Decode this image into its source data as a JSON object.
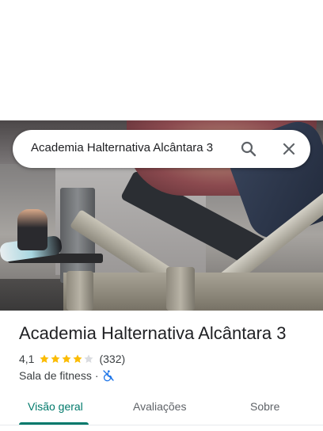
{
  "search": {
    "query": "Academia Halternativa Alcântara 3",
    "search_icon": "search-icon",
    "close_icon": "close-icon"
  },
  "place": {
    "name": "Academia Halternativa Alcântara 3",
    "rating": "4,1",
    "rating_value": 4.1,
    "review_count": "(332)",
    "category": "Sala de fitness",
    "separator": "·",
    "accessibility_icon": "wheelchair-not-accessible-icon"
  },
  "tabs": [
    {
      "label": "Visão geral",
      "active": true
    },
    {
      "label": "Avaliações",
      "active": false
    },
    {
      "label": "Sobre",
      "active": false
    }
  ],
  "colors": {
    "accent": "#00796b",
    "star": "#fbbc04",
    "star_empty": "#dadce0",
    "accessibility": "#1a73e8"
  }
}
